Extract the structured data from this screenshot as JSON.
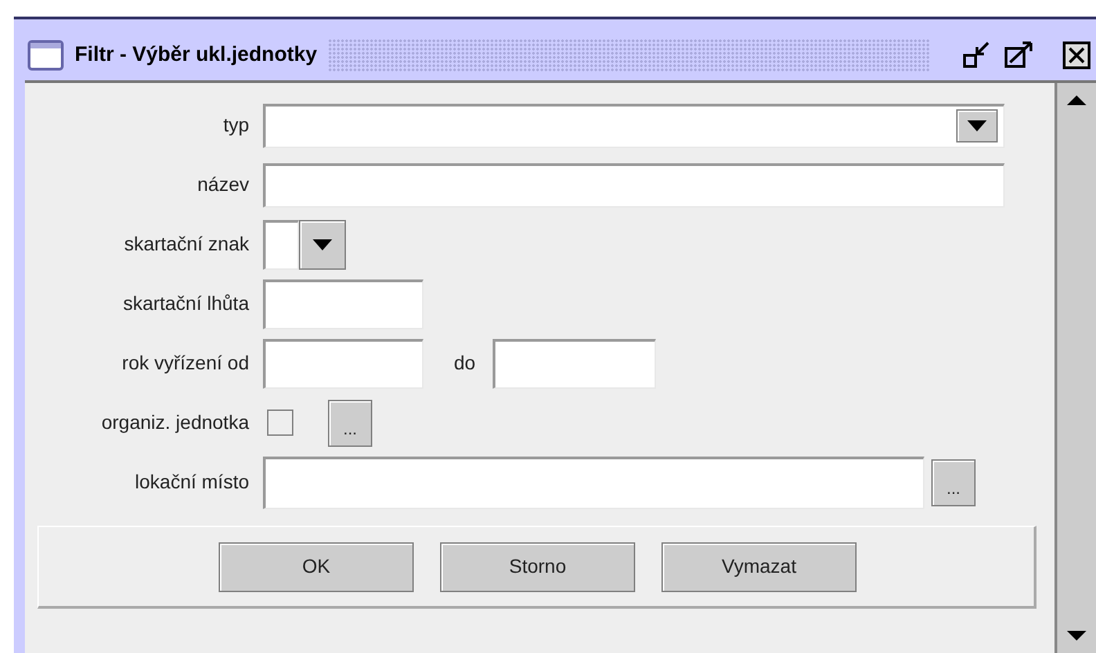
{
  "window": {
    "title": "Filtr - Výběr ukl.jednotky"
  },
  "fields": [
    {
      "kind": "combo",
      "label": "typ"
    },
    {
      "kind": "text",
      "label": "název"
    },
    {
      "kind": "small_combo",
      "label": "skartační znak"
    },
    {
      "kind": "short",
      "label": "skartační lhůta"
    },
    {
      "kind": "range",
      "label": "rok vyřízení od",
      "to_label": "do"
    },
    {
      "kind": "check_browse",
      "label": "organiz. jednotka",
      "checked": false,
      "browse": "..."
    },
    {
      "kind": "browse",
      "label": "lokační místo",
      "browse": "..."
    }
  ],
  "buttons": [
    "OK",
    "Storno",
    "Vymazat"
  ]
}
